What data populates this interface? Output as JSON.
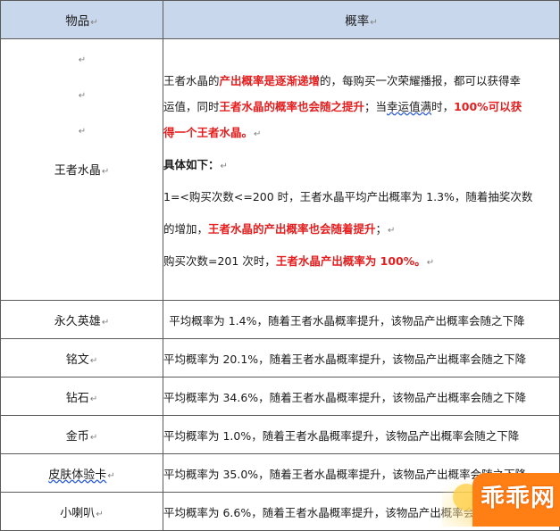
{
  "table": {
    "headers": {
      "item": "物品",
      "rate": "概率"
    },
    "para_mark": "↵",
    "main_row": {
      "item": "王者水晶",
      "line1": {
        "a": "王者水晶的",
        "b": "产出概率是逐渐递增",
        "c": "的，每购买一次荣耀播报，都可以获得幸"
      },
      "line2": {
        "a": "运值，同时",
        "b": "王者水晶的概率也会随之提升",
        "c": "；当",
        "d": "幸运值满",
        "e": "时，",
        "f": "100%可以获"
      },
      "line3": {
        "a": "得一个王者水晶。"
      },
      "line4": {
        "a": "具体如下："
      },
      "line5": {
        "a": "1=<购买次数<=200 时，王者水晶平均产出概率为 1.3%，随着抽奖次数"
      },
      "line6": {
        "a": "的增加，",
        "b": "王者水晶的产出概率也会随着提升",
        "c": "；"
      },
      "line7": {
        "a": "购买次数=201 次时，",
        "b": "王者水晶产出概率为 100%。"
      }
    },
    "rows": [
      {
        "item": "永久英雄",
        "rate": "平均概率为 1.4%，随着王者水晶概率提升，该物品产出概率会随之下降"
      },
      {
        "item": "铭文",
        "rate": "平均概率为 20.1%，随着王者水晶概率提升，该物品产出概率会随之下降"
      },
      {
        "item": "钻石",
        "rate": "平均概率为 34.6%，随着王者水晶概率提升，该物品产出概率会随之下降"
      },
      {
        "item": "金币",
        "rate": "平均概率为 1.0%，随着王者水晶概率提升，该物品产出概率会随之下降"
      },
      {
        "item": "皮肤体验卡",
        "rate": "平均概率为 35.0%，随着王者水晶概率提升，该物品产出概率会随之下降"
      },
      {
        "item": "小喇叭",
        "rate": "平均概率为 6.6%，随着王者水晶概率提升，该物品产出概率会随之下降"
      }
    ]
  },
  "watermark": {
    "text": "乖乖网"
  },
  "colors": {
    "header_bg": "#c9d7ec",
    "highlight_red": "#e41e1e",
    "watermark_orange": "#ff7f14"
  }
}
